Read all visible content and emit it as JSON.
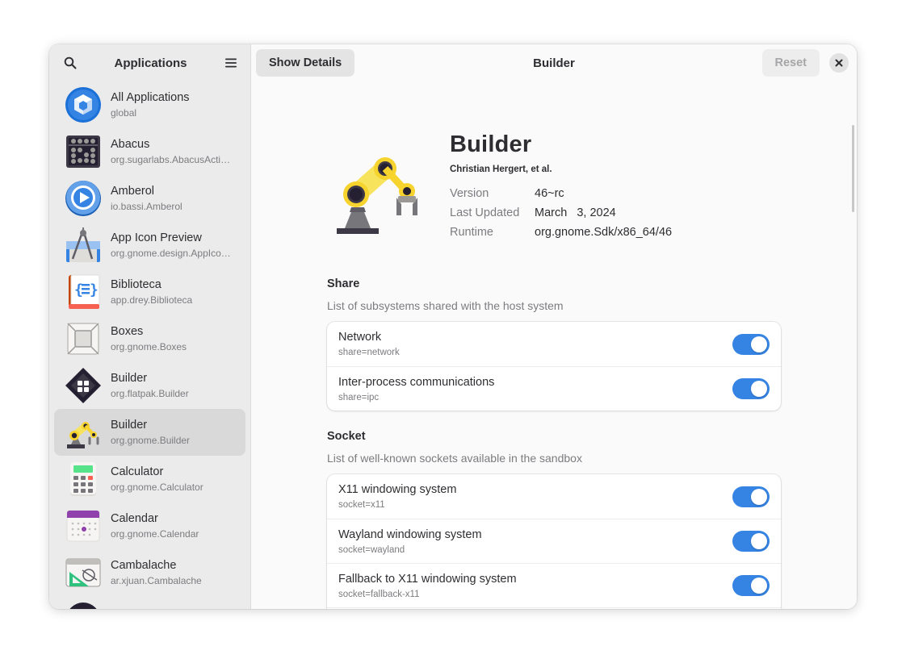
{
  "sidebar": {
    "title": "Applications",
    "apps": [
      {
        "name": "All Applications",
        "id": "global",
        "icon": "all-applications-icon"
      },
      {
        "name": "Abacus",
        "id": "org.sugarlabs.AbacusActi…",
        "icon": "abacus-icon"
      },
      {
        "name": "Amberol",
        "id": "io.bassi.Amberol",
        "icon": "amberol-icon"
      },
      {
        "name": "App Icon Preview",
        "id": "org.gnome.design.AppIco…",
        "icon": "app-icon-preview-icon"
      },
      {
        "name": "Biblioteca",
        "id": "app.drey.Biblioteca",
        "icon": "biblioteca-icon"
      },
      {
        "name": "Boxes",
        "id": "org.gnome.Boxes",
        "icon": "boxes-icon"
      },
      {
        "name": "Builder",
        "id": "org.flatpak.Builder",
        "icon": "flatpak-builder-icon"
      },
      {
        "name": "Builder",
        "id": "org.gnome.Builder",
        "icon": "gnome-builder-icon"
      },
      {
        "name": "Calculator",
        "id": "org.gnome.Calculator",
        "icon": "calculator-icon"
      },
      {
        "name": "Calendar",
        "id": "org.gnome.Calendar",
        "icon": "calendar-icon"
      },
      {
        "name": "Cambalache",
        "id": "ar.xjuan.Cambalache",
        "icon": "cambalache-icon"
      }
    ]
  },
  "header": {
    "show_details_label": "Show Details",
    "title": "Builder",
    "reset_label": "Reset"
  },
  "app": {
    "name": "Builder",
    "developer": "Christian Hergert, et al.",
    "details": [
      {
        "key": "Version",
        "value": "46~rc"
      },
      {
        "key": "Last Updated",
        "value": "March   3, 2024"
      },
      {
        "key": "Runtime",
        "value": "org.gnome.Sdk/x86_64/46"
      }
    ]
  },
  "sections": {
    "share": {
      "title": "Share",
      "description": "List of subsystems shared with the host system",
      "rows": [
        {
          "title": "Network",
          "subtitle": "share=network",
          "enabled": true
        },
        {
          "title": "Inter-process communications",
          "subtitle": "share=ipc",
          "enabled": true
        }
      ]
    },
    "socket": {
      "title": "Socket",
      "description": "List of well-known sockets available in the sandbox",
      "rows": [
        {
          "title": "X11 windowing system",
          "subtitle": "socket=x11",
          "enabled": true
        },
        {
          "title": "Wayland windowing system",
          "subtitle": "socket=wayland",
          "enabled": true
        },
        {
          "title": "Fallback to X11 windowing system",
          "subtitle": "socket=fallback-x11",
          "enabled": true
        }
      ]
    }
  },
  "colors": {
    "accent": "#3584e4",
    "sidebar_bg": "#ebebeb",
    "selected_row": "#d9d9d9"
  }
}
